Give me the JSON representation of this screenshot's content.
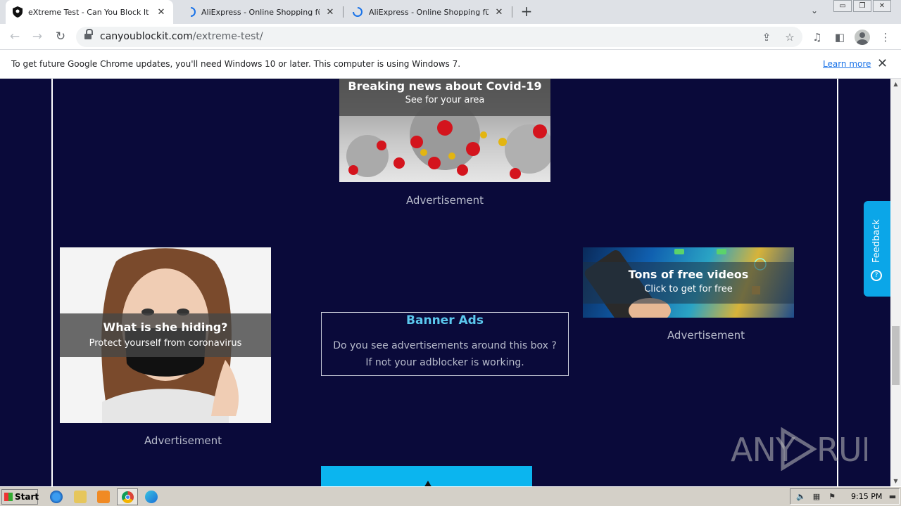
{
  "browser": {
    "tabs": [
      {
        "title": "eXtreme Test - Can You Block It ?",
        "active": true
      },
      {
        "title": "AliExpress - Online Shopping für Elek",
        "active": false
      },
      {
        "title": "AliExpress - Online Shopping für Elek",
        "active": false
      }
    ],
    "url_host": "canyoublockit.com",
    "url_path": "/extreme-test/"
  },
  "infobar": {
    "message": "To get future Google Chrome updates, you'll need Windows 10 or later. This computer is using Windows 7.",
    "link": "Learn more"
  },
  "page": {
    "ad_top": {
      "headline": "Breaking news about Covid-19",
      "subline": "See for your area",
      "caption": "Advertisement"
    },
    "ad_left": {
      "headline": "What is she hiding?",
      "subline": "Protect yourself from coronavirus",
      "caption": "Advertisement"
    },
    "ad_right": {
      "headline": "Tons of free videos",
      "subline": "Click to get for free",
      "caption": "Advertisement"
    },
    "banner": {
      "title": "Banner Ads",
      "line1": "Do you see advertisements around this box ?",
      "line2": "If not your adblocker is working."
    },
    "feedback_label": "Feedback",
    "watermark": "ANY RUN"
  },
  "taskbar": {
    "start_label": "Start",
    "time": "9:15 PM"
  },
  "colors": {
    "page_bg": "#0a0a3a",
    "banner_title": "#5bc8ee",
    "feedback": "#0ba6e8"
  }
}
